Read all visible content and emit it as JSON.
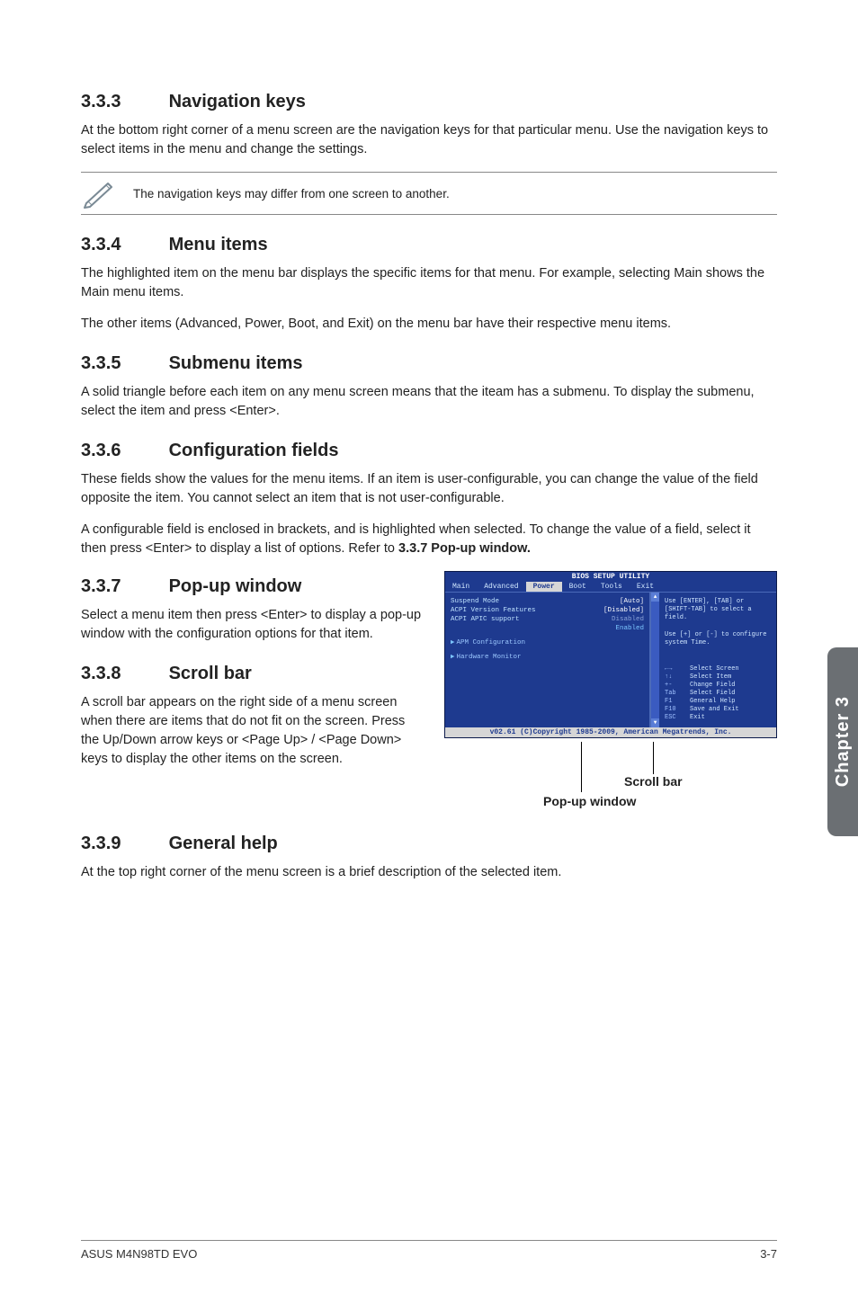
{
  "sections": {
    "s333": {
      "num": "3.3.3",
      "title": "Navigation keys",
      "p1": "At the bottom right corner of a menu screen are the navigation keys for that particular menu. Use the navigation keys to select items in the menu and change the settings."
    },
    "note": "The navigation keys may differ from one screen to another.",
    "s334": {
      "num": "3.3.4",
      "title": "Menu items",
      "p1": "The highlighted item on the menu bar displays the specific items for that menu. For example, selecting Main shows the Main menu items.",
      "p2": "The other items (Advanced, Power, Boot, and Exit) on the menu bar have their respective menu items."
    },
    "s335": {
      "num": "3.3.5",
      "title": "Submenu items",
      "p1": "A solid triangle before each item on any menu screen means that the iteam has a submenu. To display the submenu, select the item and press <Enter>."
    },
    "s336": {
      "num": "3.3.6",
      "title": "Configuration fields",
      "p1": "These fields show the values for the menu items. If an item is user-configurable, you can change the value of the field opposite the item. You cannot select an item that is not user-configurable.",
      "p2a": "A configurable field is enclosed in brackets, and is highlighted when selected. To change the value of a field, select it then press <Enter> to display a list of options. Refer to ",
      "p2b": "3.3.7 Pop-up window."
    },
    "s337": {
      "num": "3.3.7",
      "title": "Pop-up window",
      "p1": "Select a menu item then press <Enter> to display a pop-up window with the configuration options for that item."
    },
    "s338": {
      "num": "3.3.8",
      "title": "Scroll bar",
      "p1": "A scroll bar appears on the right side of a menu screen when there are items that do not fit on the screen. Press the Up/Down arrow keys or <Page Up> / <Page Down> keys to display the other items on the screen."
    },
    "s339": {
      "num": "3.3.9",
      "title": "General help",
      "p1": "At the top right corner of the menu screen is a brief description of the selected item."
    }
  },
  "bios": {
    "title": "BIOS SETUP UTILITY",
    "tabs": [
      "Main",
      "Advanced",
      "Power",
      "Boot",
      "Tools",
      "Exit"
    ],
    "active_tab": "Power",
    "rows": [
      {
        "label": "Suspend Mode",
        "value": "[Auto]",
        "cls": ""
      },
      {
        "label": "ACPI Version Features",
        "value": "[Disabled]",
        "cls": ""
      },
      {
        "label": "ACPI APIC support",
        "value": "Disabled",
        "cls": "dim"
      },
      {
        "label": "",
        "value": "Enabled",
        "cls": "en"
      }
    ],
    "subs": [
      "APM Configuration",
      "Hardware Monitor"
    ],
    "help_top": "Use [ENTER], [TAB] or [SHIFT-TAB] to select a field.\n\nUse [+] or [-] to configure system Time.",
    "nav": [
      {
        "k": "←→",
        "v": "Select Screen"
      },
      {
        "k": "↑↓",
        "v": "Select Item"
      },
      {
        "k": "+-",
        "v": "Change Field"
      },
      {
        "k": "Tab",
        "v": "Select Field"
      },
      {
        "k": "F1",
        "v": "General Help"
      },
      {
        "k": "F10",
        "v": "Save and Exit"
      },
      {
        "k": "ESC",
        "v": "Exit"
      }
    ],
    "footer": "v02.61 (C)Copyright 1985-2009, American Megatrends, Inc."
  },
  "callouts": {
    "scrollbar": "Scroll bar",
    "popup": "Pop-up window"
  },
  "sidetab": "Chapter 3",
  "footer": {
    "left": "ASUS M4N98TD EVO",
    "right": "3-7"
  }
}
